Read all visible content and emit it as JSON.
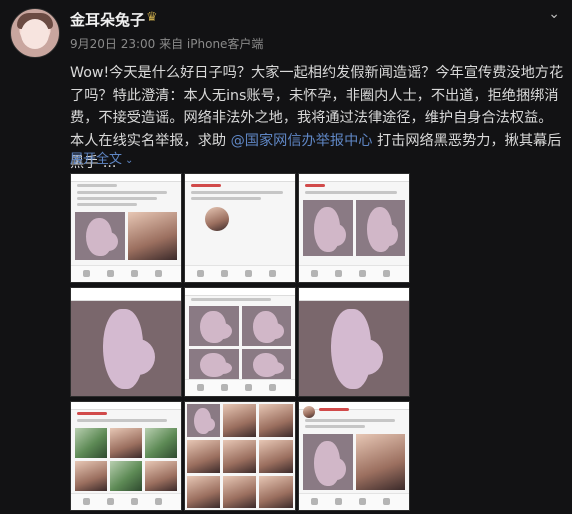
{
  "post": {
    "username": "金耳朵兔子",
    "crown_icon": "crown-icon",
    "meta": "9月20日 23:00 来自 iPhone客户端",
    "text_before": "Wow!今天是什么好日子吗？大家一起相约发假新闻造谣？今年宣传费没地方花了吗？特此澄清：本人无ins账号，未怀孕，非圈内人士，不出道，拒绝捆绑消费，不接受造谣。网络非法外之地，我将通过法律途径，维护自身合法权益。本人在线实名举报，求助 ",
    "mention": "@国家网信办举报中心",
    "text_after": " 打击网络黑恶势力，揪其幕后黑手 ...",
    "expand_label": "展开全文",
    "more_icon": "chevron-down-icon"
  },
  "gallery": {
    "image_count": 9,
    "images": [
      "screenshot-post-with-pregnant-silhouette-and-selfie",
      "screenshot-post-with-avatar-and-silhouette",
      "screenshot-post-with-two-silhouettes",
      "pregnant-silhouette-large",
      "screenshot-post-with-four-silhouettes",
      "pregnant-silhouette-large",
      "screenshot-post-with-photo-grid",
      "screenshot-post-with-photo-grid",
      "screenshot-post-with-photo-grid"
    ]
  }
}
